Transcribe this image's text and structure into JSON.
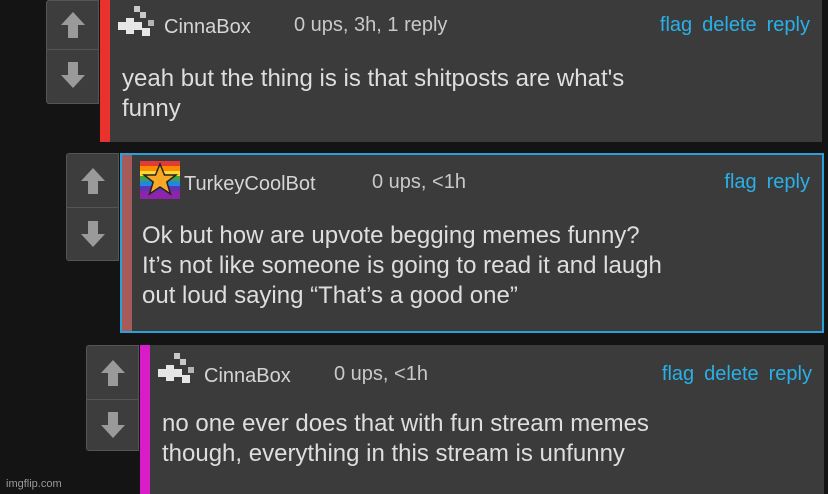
{
  "colors": {
    "link": "#2ab0e8",
    "accent_1": "#e8322b",
    "accent_2": "#a75a5a",
    "accent_3": "#d81cc8",
    "highlight_border": "#2a9fd8"
  },
  "comments": [
    {
      "username": "CinnaBox",
      "meta": "0 ups, 3h, 1 reply",
      "actions": {
        "flag": "flag",
        "delete": "delete",
        "reply": "reply"
      },
      "lines": [
        "yeah but the thing is is that shitposts are what's",
        "funny"
      ],
      "avatar_icon": "pixel-avatar-icon"
    },
    {
      "username": "TurkeyCoolBot",
      "meta": "0 ups, <1h",
      "actions": {
        "flag": "flag",
        "reply": "reply"
      },
      "lines": [
        "Ok but how are upvote begging memes funny?",
        "It’s not like someone is going to read it and laugh",
        "out loud saying “That’s a good one”"
      ],
      "avatar_icon": "rainbow-star-avatar-icon"
    },
    {
      "username": "CinnaBox",
      "meta": "0 ups, <1h",
      "actions": {
        "flag": "flag",
        "delete": "delete",
        "reply": "reply"
      },
      "lines": [
        "no one ever does that with fun stream memes",
        "though, everything in this stream is unfunny"
      ],
      "avatar_icon": "pixel-avatar-icon"
    }
  ],
  "watermark": "imgflip.com"
}
